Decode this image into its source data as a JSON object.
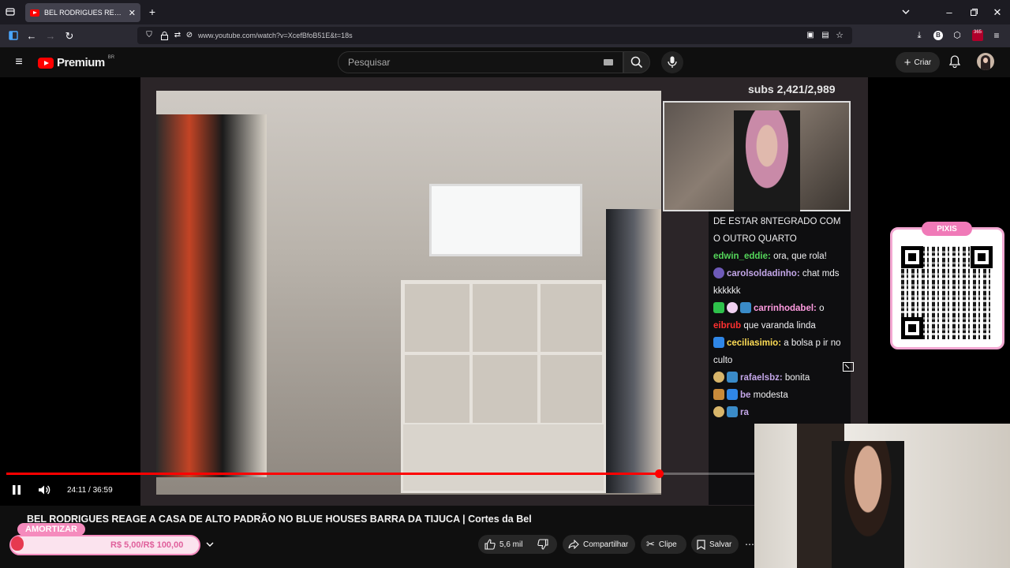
{
  "browser": {
    "tab_title": "BEL RODRIGUES REAGE A C",
    "url": "www.youtube.com/watch?v=XcefBfoB51E&t=18s",
    "new_tab": "+",
    "ext_badge": "365"
  },
  "youtube": {
    "logo_text": "Premium",
    "logo_region": "BR",
    "search_placeholder": "Pesquisar",
    "create_label": "Criar"
  },
  "overlay": {
    "subs_text": "subs 2,421/2,989",
    "pixis_label": "PIXIS"
  },
  "chat": [
    {
      "user": "",
      "text": "DE ESTAR 8NTEGRADO COM O OUTRO QUARTO",
      "cls": ""
    },
    {
      "user": "edwin_eddie:",
      "text": "ora, que rola!",
      "cls": "u1"
    },
    {
      "user": "carolsoldadinho:",
      "text": "chat mds kkkkkk",
      "cls": "u2"
    },
    {
      "user": "carrinhodabel:",
      "text": "o",
      "cls": "u3"
    },
    {
      "user": "eibrub",
      "text": "que varanda linda",
      "cls": "u4"
    },
    {
      "user": "ceciliasimio:",
      "text": "a bolsa p ir no culto",
      "cls": "u5"
    },
    {
      "user": "rafaelsbz:",
      "text": "bonita",
      "cls": "u2"
    },
    {
      "user": "be",
      "text": "modesta",
      "cls": "u2"
    },
    {
      "user": "ra",
      "text": "",
      "cls": "u2"
    }
  ],
  "player": {
    "time": "24:11 / 36:59",
    "progress_fraction": 0.654
  },
  "video": {
    "title": "BEL RODRIGUES REAGE A CASA DE ALTO PADRÃO NO BLUE HOUSES BARRA DA TIJUCA | Cortes da Bel"
  },
  "donation": {
    "label": "AMORTIZAR",
    "value": "R$ 5,00/R$ 100,00"
  },
  "actions": {
    "likes": "5,6 mil",
    "share": "Compartilhar",
    "clip": "Clipe",
    "save": "Salvar"
  }
}
